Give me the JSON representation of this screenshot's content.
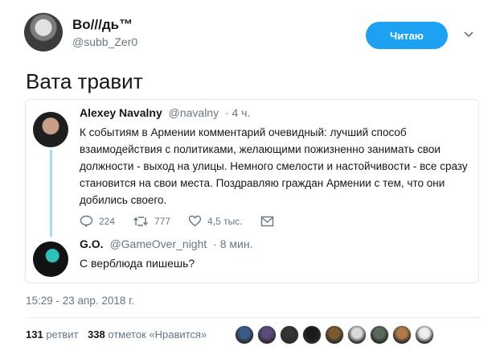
{
  "author": {
    "display_name": "Bo///дь™",
    "username": "@subb_Zer0"
  },
  "follow_button": {
    "label": "Читаю",
    "color": "#1da1f2"
  },
  "tweet_text": "Вата травит",
  "quoted": {
    "name": "Alexey Navalny",
    "handle": "@navalny",
    "time": "· 4 ч.",
    "text": "К событиям в Армении комментарий очевидный: лучший способ взаимодействия с политиками, желающими пожизненно занимать свои должности - выход на улицы. Немного смелости и настойчивости - все сразу становится на свои места. Поздравляю граждан Армении с тем, что они добились своего.",
    "replies": "224",
    "retweets": "777",
    "likes": "4,5 тыс.",
    "thread_line_color": "#a7d8f6"
  },
  "reply": {
    "name": "G.O.",
    "handle": "@GameOver_night",
    "time": "· 8 мин.",
    "text": "С верблюда пишешь?"
  },
  "timestamp": "15:29 - 23 апр. 2018 г.",
  "stats": {
    "retweets_count": "131",
    "retweets_label": "ретвит",
    "likes_count": "338",
    "likes_label": "отметок «Нравится»"
  },
  "liker_colors": [
    "#3b5a8a",
    "#5b4a7a",
    "#333333",
    "#1a1a1a",
    "#7a5a2e",
    "#d8d8d8",
    "#5a6a5a",
    "#b07a4a",
    "#eeeeee"
  ]
}
